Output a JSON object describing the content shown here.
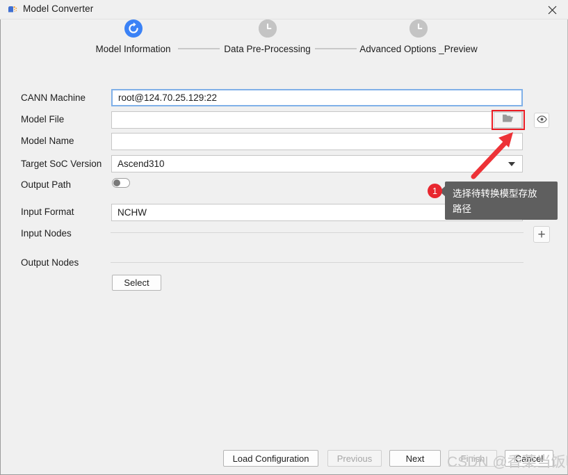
{
  "window": {
    "title": "Model Converter",
    "app_icon": "model-converter-icon",
    "close_icon": "close-icon"
  },
  "stepper": {
    "steps": [
      {
        "label": "Model Information",
        "state": "active",
        "icon": "refresh-icon"
      },
      {
        "label": "Data Pre-Processing",
        "state": "pending",
        "icon": "clock-icon"
      },
      {
        "label": "Advanced Options _Preview",
        "state": "pending",
        "icon": "clock-icon"
      }
    ]
  },
  "form": {
    "cann_machine": {
      "label": "CANN Machine",
      "value": "root@124.70.25.129:22",
      "placeholder": ""
    },
    "model_file": {
      "label": "Model File",
      "value": "",
      "placeholder": "",
      "browse_icon": "folder-icon",
      "preview_icon": "eye-icon"
    },
    "model_name": {
      "label": "Model Name",
      "value": "",
      "placeholder": ""
    },
    "target_soc_version": {
      "label": "Target SoC Version",
      "value": "Ascend310",
      "caret_icon": "chevron-down-icon"
    },
    "output_path": {
      "label": "Output Path",
      "toggle_state": "off"
    },
    "input_format": {
      "label": "Input Format",
      "value": "NCHW",
      "caret_icon": "chevron-down-icon"
    },
    "input_nodes": {
      "label": "Input Nodes",
      "add_label": "+",
      "add_icon": "plus-icon"
    },
    "output_nodes": {
      "label": "Output Nodes",
      "select_label": "Select"
    }
  },
  "footer": {
    "load_configuration": "Load Configuration",
    "previous": "Previous",
    "next": "Next",
    "finish": "Finish",
    "cancel": "Cancel"
  },
  "annotations": {
    "badge_number": "1",
    "tooltip_line1": "选择待转换模型存放",
    "tooltip_line2": "路径",
    "highlight_color": "#ec1c24",
    "arrow_color": "#ed3237"
  },
  "watermark": {
    "text": "CSDN @香菜当饭吃"
  }
}
